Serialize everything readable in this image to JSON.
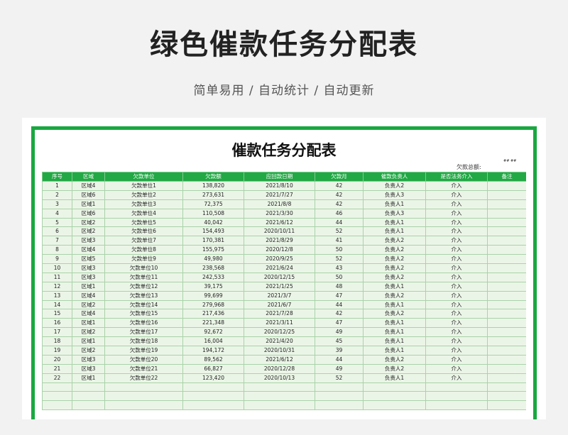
{
  "page": {
    "title": "绿色催款任务分配表",
    "subtitle": "简单易用 / 自动统计 / 自动更新"
  },
  "sheet": {
    "title": "催款任务分配表",
    "total_label": "欠款总额:",
    "total_value": "## ##",
    "columns": [
      "序号",
      "区域",
      "欠款单位",
      "欠款额",
      "应回款日期",
      "欠款月",
      "催款负责人",
      "是否法务介入",
      "备注"
    ],
    "rows": [
      [
        "1",
        "区域4",
        "欠款单位1",
        "138,820",
        "2021/8/10",
        "42",
        "负责人2",
        "介入",
        ""
      ],
      [
        "2",
        "区域6",
        "欠款单位2",
        "273,631",
        "2021/7/27",
        "42",
        "负责人3",
        "介入",
        ""
      ],
      [
        "3",
        "区域1",
        "欠款单位3",
        "72,375",
        "2021/8/8",
        "42",
        "负责人1",
        "介入",
        ""
      ],
      [
        "4",
        "区域6",
        "欠款单位4",
        "110,508",
        "2021/3/30",
        "46",
        "负责人3",
        "介入",
        ""
      ],
      [
        "5",
        "区域2",
        "欠款单位5",
        "40,042",
        "2021/6/12",
        "44",
        "负责人1",
        "介入",
        ""
      ],
      [
        "6",
        "区域2",
        "欠款单位6",
        "154,493",
        "2020/10/11",
        "52",
        "负责人1",
        "介入",
        ""
      ],
      [
        "7",
        "区域3",
        "欠款单位7",
        "170,381",
        "2021/8/29",
        "41",
        "负责人2",
        "介入",
        ""
      ],
      [
        "8",
        "区域4",
        "欠款单位8",
        "155,975",
        "2020/12/8",
        "50",
        "负责人2",
        "介入",
        ""
      ],
      [
        "9",
        "区域5",
        "欠款单位9",
        "49,980",
        "2020/9/25",
        "52",
        "负责人2",
        "介入",
        ""
      ],
      [
        "10",
        "区域3",
        "欠款单位10",
        "238,568",
        "2021/6/24",
        "43",
        "负责人2",
        "介入",
        ""
      ],
      [
        "11",
        "区域3",
        "欠款单位11",
        "242,533",
        "2020/12/15",
        "50",
        "负责人2",
        "介入",
        ""
      ],
      [
        "12",
        "区域1",
        "欠款单位12",
        "39,175",
        "2021/1/25",
        "48",
        "负责人1",
        "介入",
        ""
      ],
      [
        "13",
        "区域4",
        "欠款单位13",
        "99,699",
        "2021/3/7",
        "47",
        "负责人2",
        "介入",
        ""
      ],
      [
        "14",
        "区域2",
        "欠款单位14",
        "279,968",
        "2021/6/7",
        "44",
        "负责人1",
        "介入",
        ""
      ],
      [
        "15",
        "区域4",
        "欠款单位15",
        "217,436",
        "2021/7/28",
        "42",
        "负责人2",
        "介入",
        ""
      ],
      [
        "16",
        "区域1",
        "欠款单位16",
        "221,348",
        "2021/3/11",
        "47",
        "负责人1",
        "介入",
        ""
      ],
      [
        "17",
        "区域2",
        "欠款单位17",
        "92,672",
        "2020/12/25",
        "49",
        "负责人1",
        "介入",
        ""
      ],
      [
        "18",
        "区域1",
        "欠款单位18",
        "16,004",
        "2021/4/20",
        "45",
        "负责人1",
        "介入",
        ""
      ],
      [
        "19",
        "区域2",
        "欠款单位19",
        "194,172",
        "2020/10/31",
        "39",
        "负责人1",
        "介入",
        ""
      ],
      [
        "20",
        "区域3",
        "欠款单位20",
        "89,562",
        "2021/6/12",
        "44",
        "负责人2",
        "介入",
        ""
      ],
      [
        "21",
        "区域3",
        "欠款单位21",
        "66,827",
        "2020/12/28",
        "49",
        "负责人2",
        "介入",
        ""
      ],
      [
        "22",
        "区域1",
        "欠款单位22",
        "123,420",
        "2020/10/13",
        "52",
        "负责人1",
        "介入",
        ""
      ]
    ],
    "blank_rows": 3
  },
  "colors": {
    "accent": "#19a840",
    "header_bg": "#22a845",
    "cell_bg": "#ebf5e7"
  }
}
